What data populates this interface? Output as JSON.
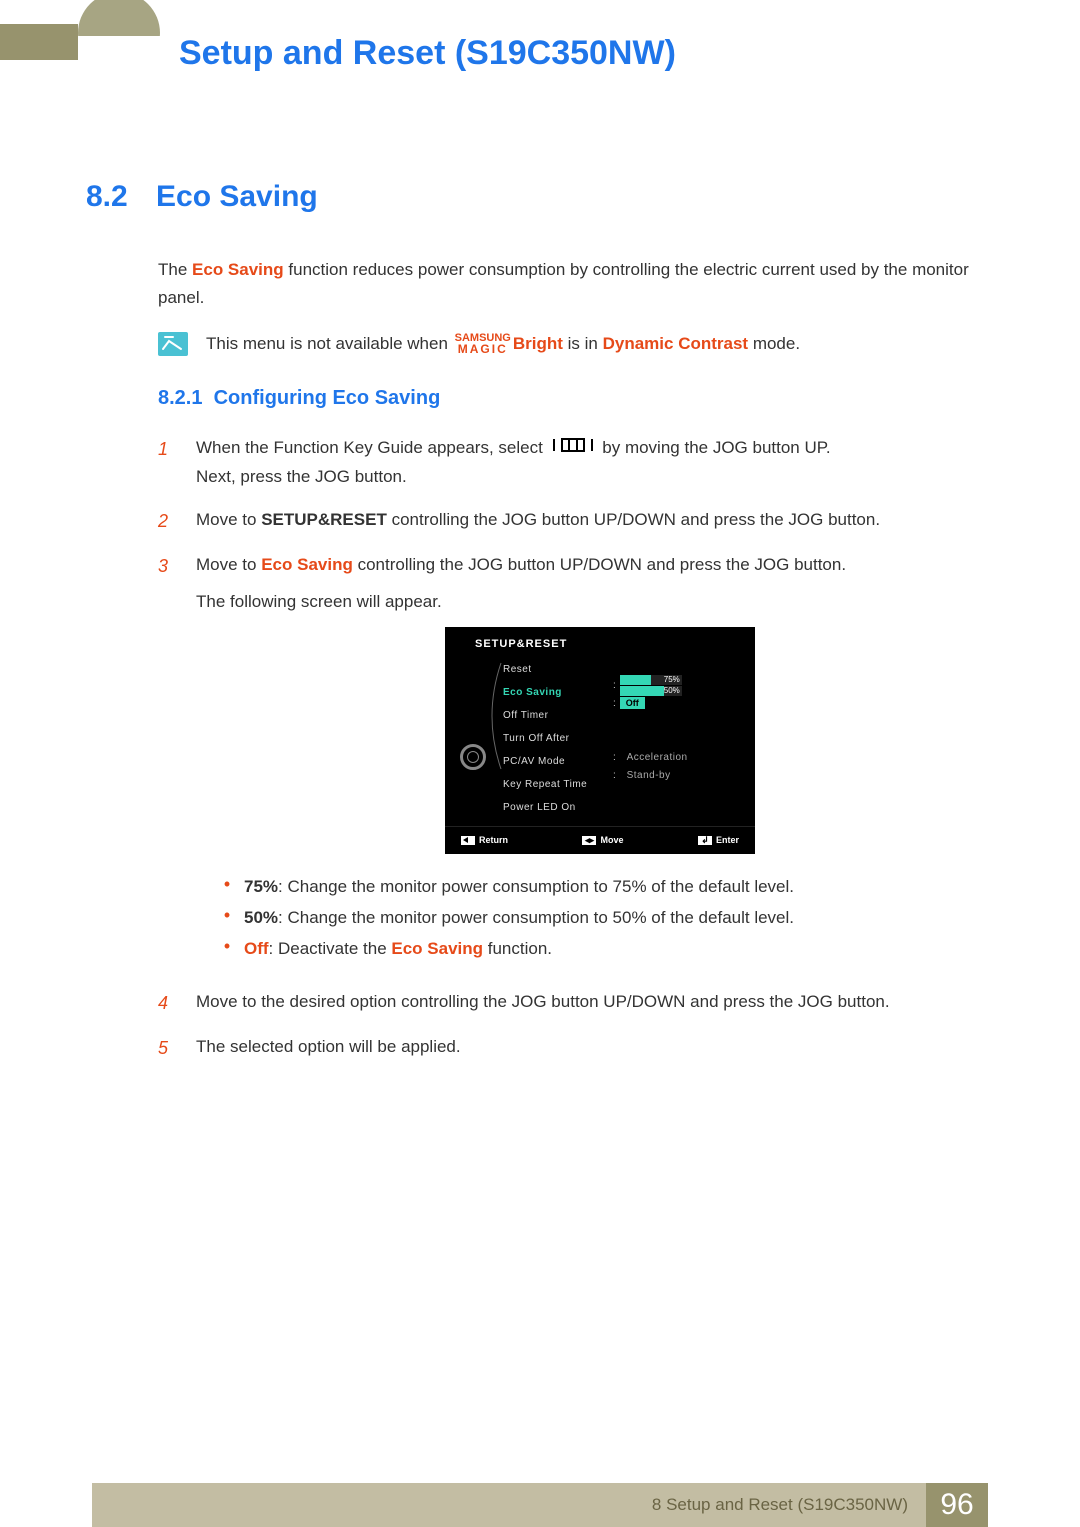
{
  "header": {
    "title": "Setup and Reset (S19C350NW)"
  },
  "section": {
    "number": "8.2",
    "title": "Eco Saving"
  },
  "intro": {
    "pre": "The ",
    "term": "Eco Saving",
    "post": " function reduces power consumption by controlling the electric current used by the monitor panel."
  },
  "note": {
    "pre": "This menu is not available when ",
    "magic_top": "SAMSUNG",
    "magic_bot": "MAGIC",
    "bright": "Bright",
    "mid": " is in ",
    "mode": "Dynamic Contrast",
    "post": " mode."
  },
  "subsection": {
    "number": "8.2.1",
    "title": "Configuring Eco Saving"
  },
  "steps": {
    "s1": {
      "n": "1",
      "a": "When the Function Key Guide appears, select ",
      "b": " by moving the JOG button UP.",
      "c": "Next, press the JOG button."
    },
    "s2": {
      "n": "2",
      "a": "Move to ",
      "k": "SETUP&RESET",
      "b": " controlling the JOG button UP/DOWN and press the JOG button."
    },
    "s3": {
      "n": "3",
      "a": "Move to ",
      "k": "Eco Saving",
      "b": " controlling the JOG button UP/DOWN and press the JOG button.",
      "c": "The following screen will appear."
    },
    "s4": {
      "n": "4",
      "a": "Move to the desired option controlling the JOG button UP/DOWN and press the JOG button."
    },
    "s5": {
      "n": "5",
      "a": "The selected option will be applied."
    }
  },
  "osd": {
    "title": "SETUP&RESET",
    "menu": {
      "reset": "Reset",
      "eco": "Eco Saving",
      "offtimer": "Off Timer",
      "turnoff": "Turn Off After",
      "pcav": "PC/AV Mode",
      "keyrep": "Key Repeat Time",
      "powerled": "Power LED On"
    },
    "vals": {
      "p75": "75%",
      "p50": "50%",
      "off": "Off",
      "accel": "Acceleration",
      "standby": "Stand-by"
    },
    "footer": {
      "return": "Return",
      "move": "Move",
      "enter": "Enter"
    }
  },
  "bullets": {
    "b1": {
      "k": "75%",
      "t": ": Change the monitor power consumption to 75% of the default level."
    },
    "b2": {
      "k": "50%",
      "t": ": Change the monitor power consumption to 50% of the default level."
    },
    "b3": {
      "k": "Off",
      "m": ": Deactivate the ",
      "k2": "Eco Saving",
      "t": " function."
    }
  },
  "footer": {
    "chapter": "8 Setup and Reset (S19C350NW)",
    "page": "96"
  }
}
